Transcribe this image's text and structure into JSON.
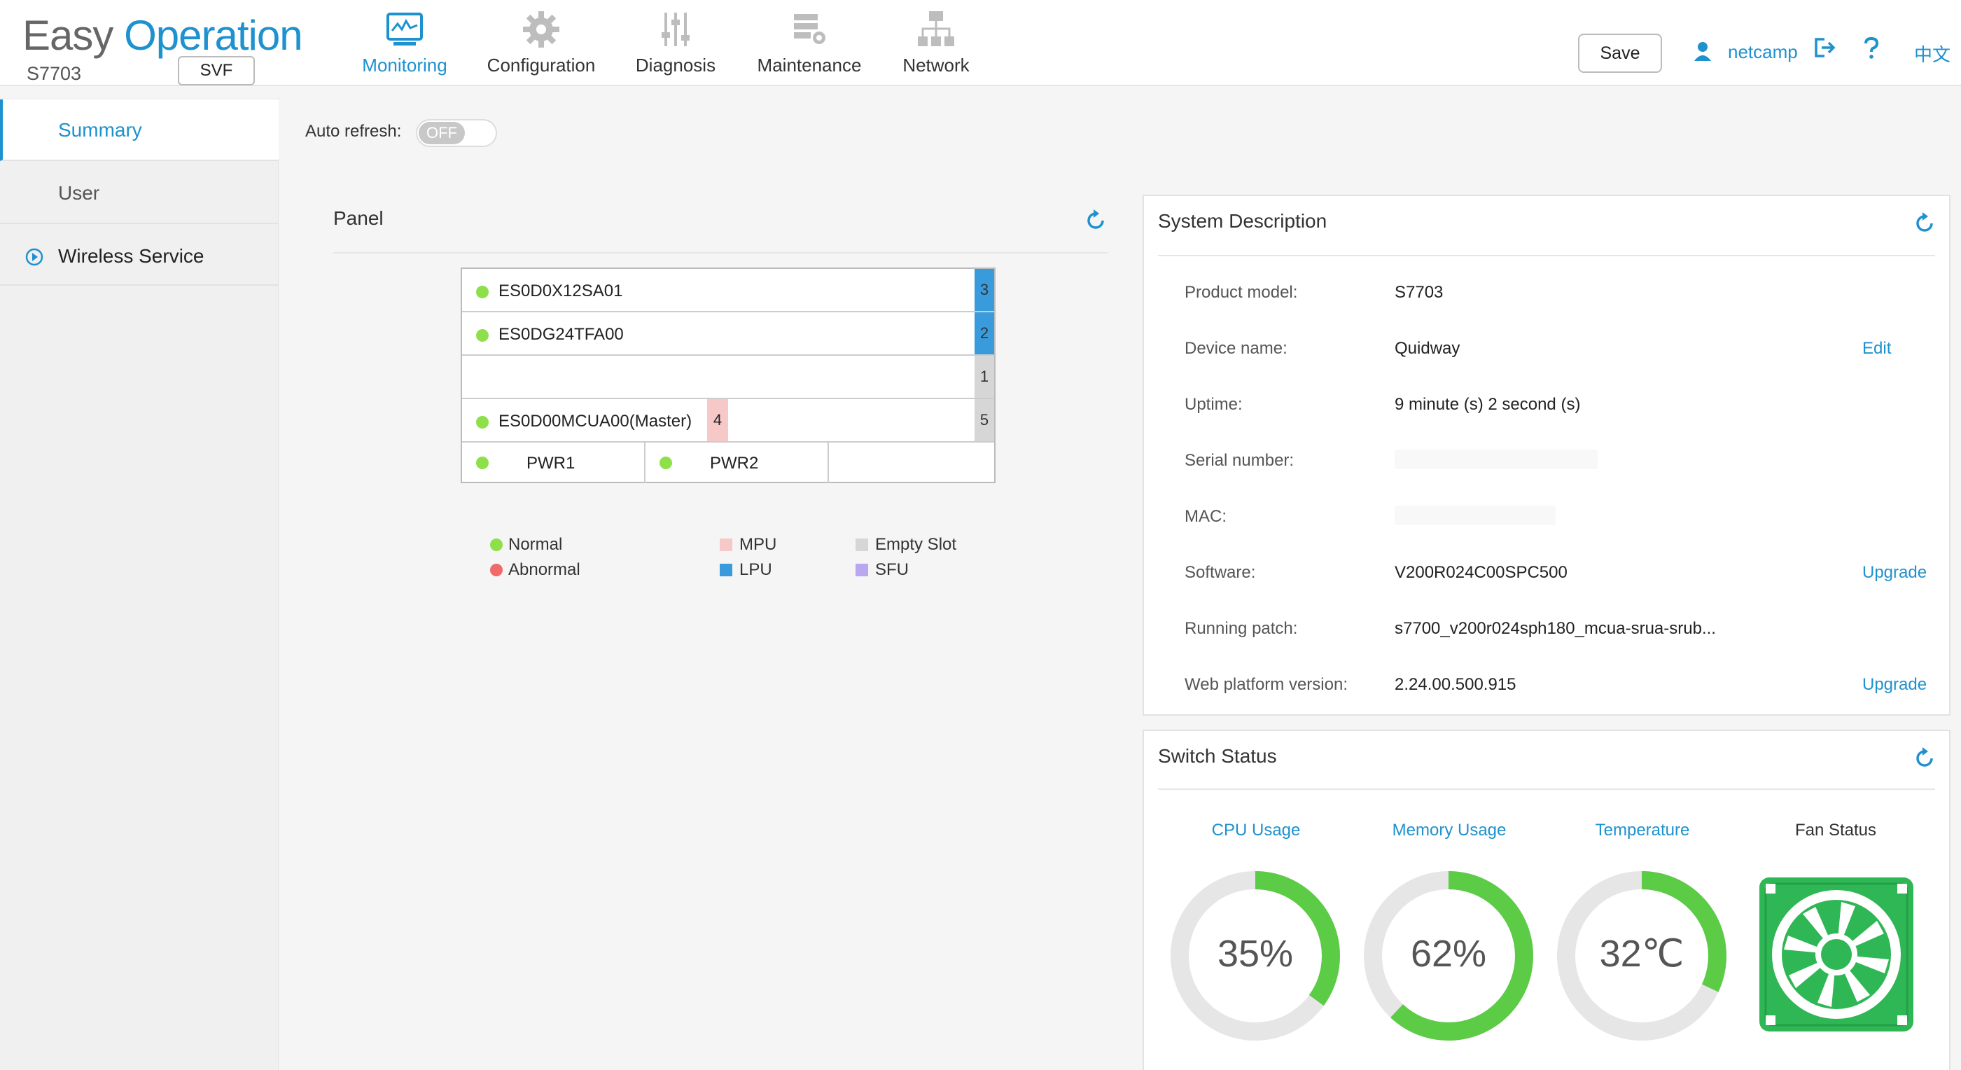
{
  "app": {
    "logo_word1": "Easy",
    "logo_word2": "Operation",
    "model": "S7703",
    "mode_button": "SVF"
  },
  "nav": {
    "items": [
      {
        "label": "Monitoring",
        "icon": "monitor-icon",
        "active": true
      },
      {
        "label": "Configuration",
        "icon": "gear-icon"
      },
      {
        "label": "Diagnosis",
        "icon": "sliders-icon"
      },
      {
        "label": "Maintenance",
        "icon": "maintenance-icon"
      },
      {
        "label": "Network",
        "icon": "network-topology-icon"
      }
    ]
  },
  "header": {
    "save_label": "Save",
    "username": "netcamp",
    "logout_icon": "logout-icon",
    "help_icon": "help-icon",
    "language": "中文"
  },
  "sidebar": {
    "items": [
      {
        "label": "Summary",
        "active": true
      },
      {
        "label": "User"
      },
      {
        "label": "Wireless Service",
        "group": true,
        "icon": "expand-circle-icon"
      }
    ]
  },
  "auto_refresh": {
    "label": "Auto refresh:",
    "state": "OFF"
  },
  "panel": {
    "title": "Panel",
    "slots": [
      {
        "name": "ES0D0X12SA01",
        "num": "3",
        "type": "lpu",
        "status": "normal"
      },
      {
        "name": "ES0DG24TFA00",
        "num": "2",
        "type": "lpu",
        "status": "normal"
      },
      {
        "name": "",
        "num": "1",
        "type": "empty"
      },
      {
        "name": "ES0D00MCUA00(Master)",
        "num": "5",
        "type": "empty",
        "mpu_num": "4",
        "status": "normal"
      }
    ],
    "power": [
      {
        "name": "PWR1",
        "status": "normal"
      },
      {
        "name": "PWR2",
        "status": "normal"
      }
    ],
    "legend": {
      "normal": "Normal",
      "abnormal": "Abnormal",
      "mpu": "MPU",
      "lpu": "LPU",
      "empty": "Empty Slot",
      "sfu": "SFU"
    },
    "colors": {
      "normal": "#8ee04a",
      "abnormal": "#f06a6a",
      "mpu": "#f7c8c8",
      "lpu": "#3a9bdc",
      "empty": "#d6d6d6",
      "sfu": "#b9a8f0"
    }
  },
  "system_description": {
    "title": "System Description",
    "rows": [
      {
        "label": "Product model:",
        "value": "S7703"
      },
      {
        "label": "Device name:",
        "value": "Quidway",
        "action": "Edit"
      },
      {
        "label": "Uptime:",
        "value": "9 minute (s) 2 second (s)"
      },
      {
        "label": "Serial number:",
        "value": ""
      },
      {
        "label": "MAC:",
        "value": ""
      },
      {
        "label": "Software:",
        "value": "V200R024C00SPC500",
        "action": "Upgrade"
      },
      {
        "label": "Running patch:",
        "value": "s7700_v200r024sph180_mcua-srua-srub..."
      },
      {
        "label": "Web platform version:",
        "value": "2.24.00.500.915",
        "action": "Upgrade"
      }
    ]
  },
  "switch_status": {
    "title": "Switch Status",
    "cpu": {
      "label": "CPU Usage",
      "display": "35%",
      "percent": 35
    },
    "memory": {
      "label": "Memory Usage",
      "display": "62%",
      "percent": 62
    },
    "temperature": {
      "label": "Temperature",
      "display": "32℃",
      "percent": 32
    },
    "fan": {
      "label": "Fan Status",
      "icon": "fan-icon"
    }
  },
  "theme": {
    "accent": "#1e91cf",
    "gauge_fill": "#5ccb46",
    "gauge_track": "#e6e6e6"
  }
}
